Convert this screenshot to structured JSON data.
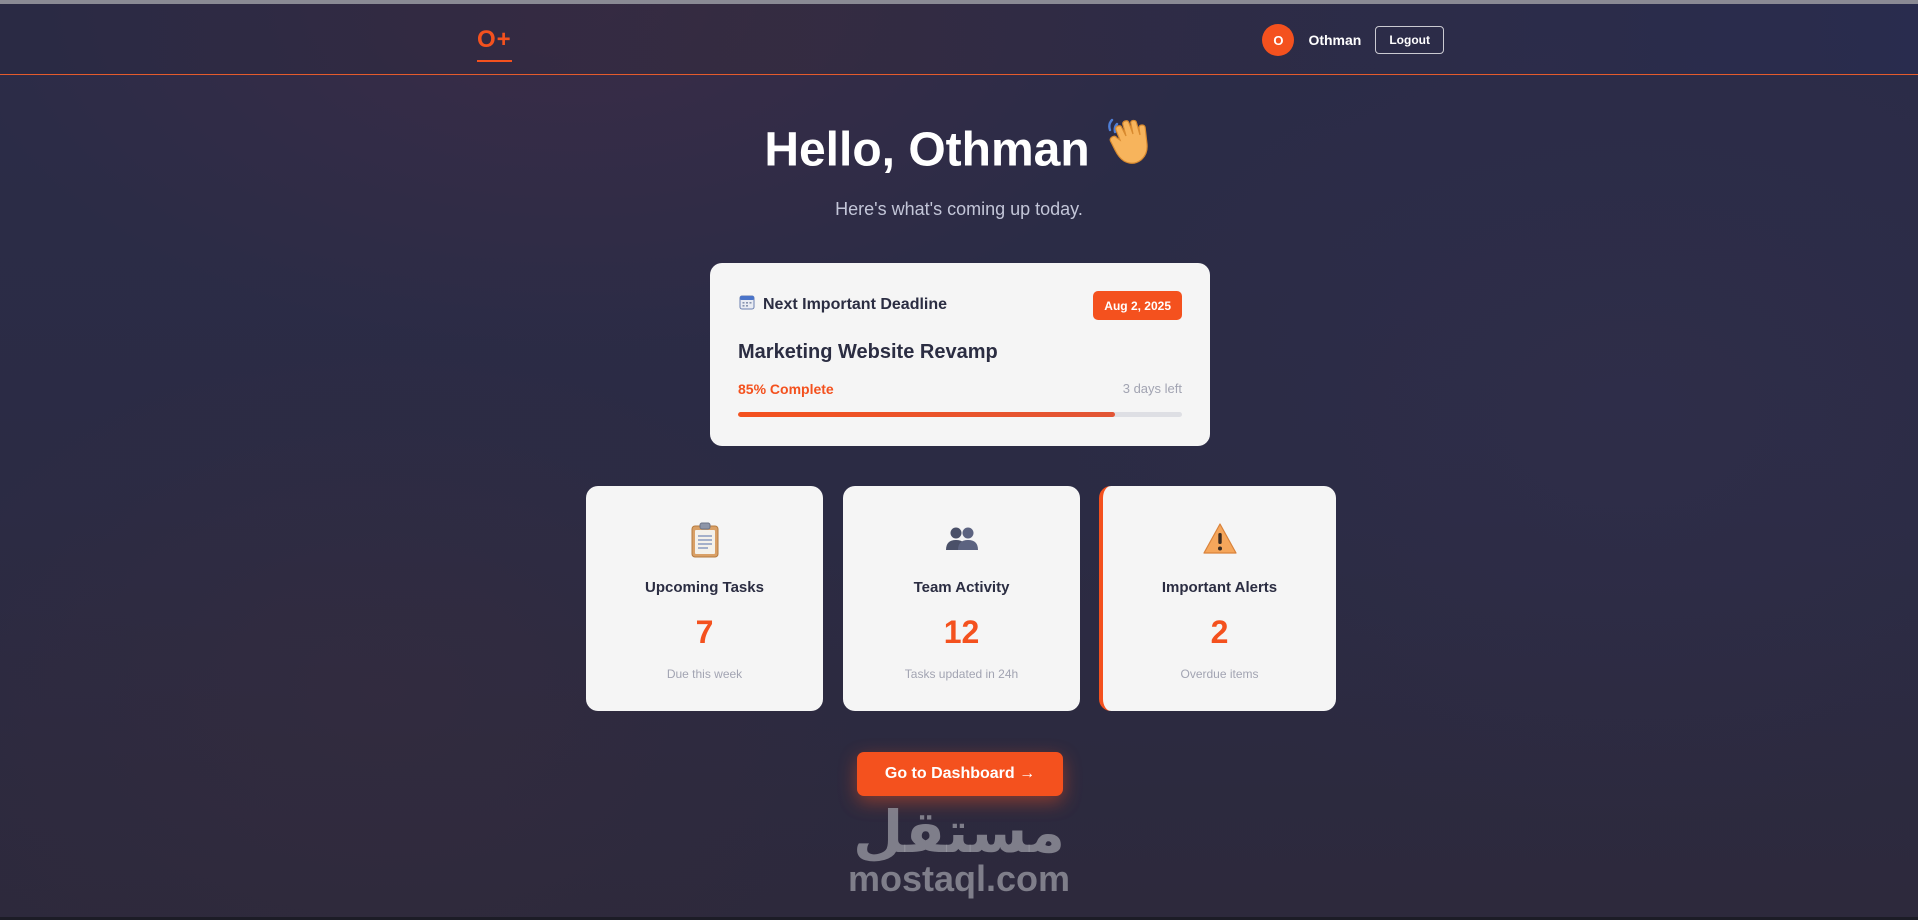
{
  "header": {
    "logo": "O+",
    "user": {
      "initial": "O",
      "name": "Othman"
    },
    "logout_label": "Logout"
  },
  "hero": {
    "greeting": "Hello, Othman",
    "greeting_icon": "waving-hand-icon",
    "subtitle": "Here's what's coming up today."
  },
  "deadline": {
    "icon": "calendar-icon",
    "label": "Next Important Deadline",
    "date": "Aug 2, 2025",
    "project": "Marketing Website Revamp",
    "progress_label": "85% Complete",
    "progress_percent": 85,
    "days_left": "3 days left"
  },
  "stats": [
    {
      "icon": "clipboard-icon",
      "title": "Upcoming Tasks",
      "value": "7",
      "caption": "Due this week"
    },
    {
      "icon": "team-icon",
      "title": "Team Activity",
      "value": "12",
      "caption": "Tasks updated in 24h"
    },
    {
      "icon": "warning-icon",
      "title": "Important Alerts",
      "value": "2",
      "caption": "Overdue items"
    }
  ],
  "cta": {
    "label": "Go to Dashboard →"
  },
  "watermark": {
    "arabic": "مستقل",
    "latin": "mostaql.com"
  },
  "colors": {
    "accent": "#f4511e",
    "card_bg": "#f5f5f5",
    "text_dark": "#2b2d42",
    "muted": "#a2a4b2"
  }
}
